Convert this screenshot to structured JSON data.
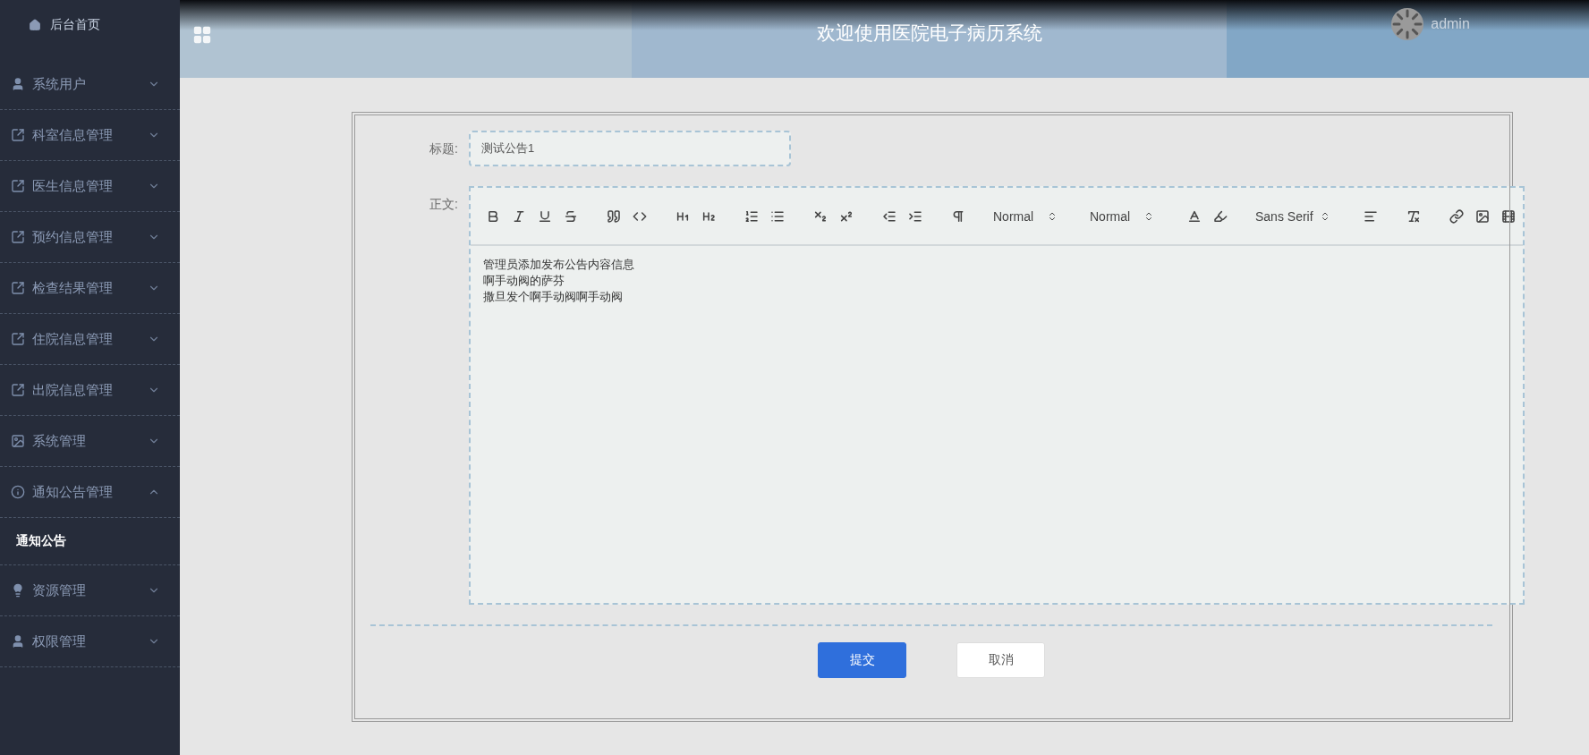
{
  "header": {
    "title": "欢迎使用医院电子病历系统",
    "user": "admin"
  },
  "sidebar": {
    "home": "后台首页",
    "items": [
      {
        "label": "系统用户",
        "kind": "user",
        "expanded": false
      },
      {
        "label": "科室信息管理",
        "kind": "module",
        "expanded": false
      },
      {
        "label": "医生信息管理",
        "kind": "module",
        "expanded": false
      },
      {
        "label": "预约信息管理",
        "kind": "module",
        "expanded": false
      },
      {
        "label": "检查结果管理",
        "kind": "module",
        "expanded": false
      },
      {
        "label": "住院信息管理",
        "kind": "module",
        "expanded": false
      },
      {
        "label": "出院信息管理",
        "kind": "module",
        "expanded": false
      },
      {
        "label": "系统管理",
        "kind": "media",
        "expanded": false
      },
      {
        "label": "通知公告管理",
        "kind": "notice",
        "expanded": true,
        "children": [
          {
            "label": "通知公告",
            "selected": true
          }
        ]
      },
      {
        "label": "资源管理",
        "kind": "resource",
        "expanded": false
      },
      {
        "label": "权限管理",
        "kind": "user",
        "expanded": false
      }
    ]
  },
  "form": {
    "title_label": "标题:",
    "title_value": "测试公告1",
    "body_label": "正文:",
    "editor": {
      "pickers": [
        "Normal",
        "Normal",
        "Sans Serif"
      ],
      "body_lines": [
        "管理员添加发布公告内容信息",
        "啊手动阀的萨芬",
        "撒旦发个啊手动阀啊手动阀"
      ]
    },
    "buttons": [
      {
        "label": "提交",
        "kind": "primary"
      },
      {
        "label": "取消",
        "kind": "secondary"
      }
    ]
  }
}
